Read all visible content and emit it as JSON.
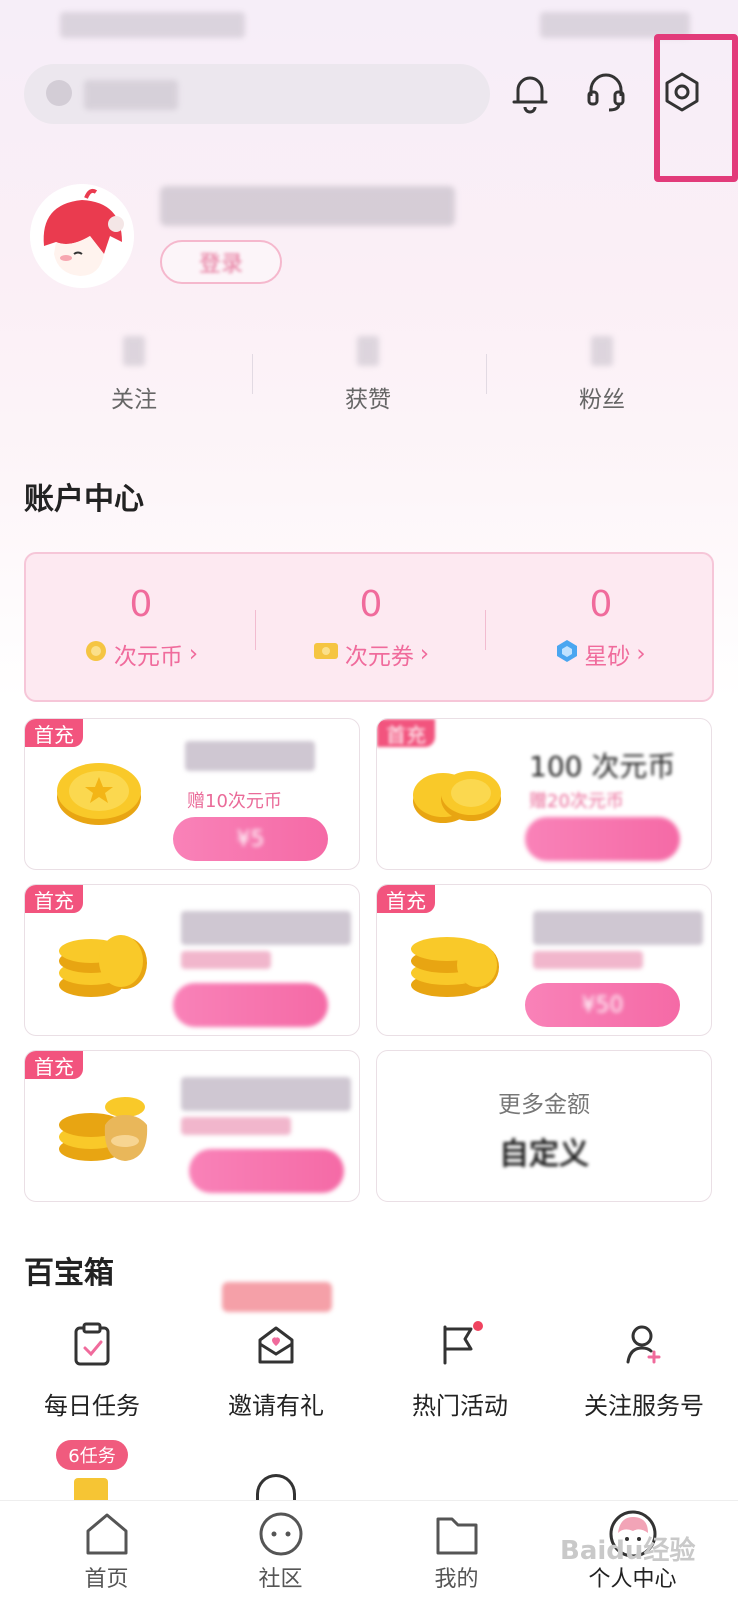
{
  "search": {
    "placeholder": ""
  },
  "profile": {
    "login_label": "登录"
  },
  "stats": [
    {
      "label": "关注"
    },
    {
      "label": "获赞"
    },
    {
      "label": "粉丝"
    }
  ],
  "account": {
    "title": "账户中心",
    "items": [
      {
        "value": "0",
        "label": "次元币"
      },
      {
        "value": "0",
        "label": "次元券"
      },
      {
        "value": "0",
        "label": "星砂"
      }
    ]
  },
  "recharge": {
    "tag": "首充",
    "items": [
      {
        "bonus": "赠10次元币",
        "price": "¥5"
      },
      {
        "title": "100 次元币",
        "bonus": "赠20次元币"
      },
      {
        "bonus": ""
      },
      {
        "price": "¥50"
      },
      {
        "bonus": ""
      }
    ],
    "custom": {
      "top": "更多金额",
      "bottom": "自定义"
    }
  },
  "toolbox": {
    "title": "百宝箱",
    "items": [
      {
        "label": "每日任务"
      },
      {
        "label": "邀请有礼"
      },
      {
        "label": "热门活动"
      },
      {
        "label": "关注服务号"
      }
    ],
    "task_badge": "6任务"
  },
  "tabs": [
    {
      "label": "首页"
    },
    {
      "label": "社区"
    },
    {
      "label": "我的"
    },
    {
      "label": "个人中心"
    }
  ],
  "watermark": "Baidu经验",
  "colors": {
    "accent": "#f06b9c",
    "highlight": "#e23b7a",
    "tag": "#f2547e"
  },
  "icons": [
    "bell-icon",
    "headset-icon",
    "settings-hexagon-icon",
    "home-icon",
    "community-icon",
    "folder-icon",
    "profile-icon"
  ]
}
